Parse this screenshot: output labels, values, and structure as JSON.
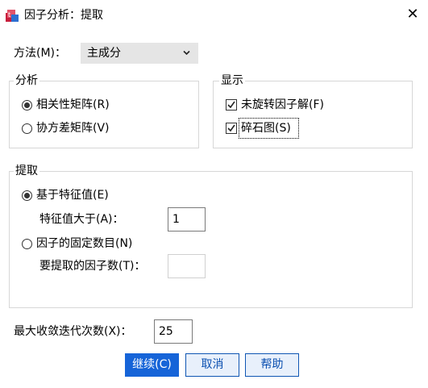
{
  "window": {
    "title": "因子分析：提取",
    "icon": "factor-analysis-app-icon",
    "close_icon": "close-icon"
  },
  "method": {
    "label": "方法(M)：",
    "value": "主成分"
  },
  "analyze": {
    "legend": "分析",
    "options": [
      {
        "label": "相关性矩阵(R)",
        "selected": true
      },
      {
        "label": "协方差矩阵(V)",
        "selected": false
      }
    ]
  },
  "display": {
    "legend": "显示",
    "options": [
      {
        "label": "未旋转因子解(F)",
        "checked": true
      },
      {
        "label": "碎石图(S)",
        "checked": true
      }
    ]
  },
  "extract": {
    "legend": "提取",
    "based_on_eigen_label": "基于特征值(E)",
    "eigen_greater_label": "特征值大于(A)：",
    "eigen_value": "1",
    "fixed_count_label": "因子的固定数目(N)",
    "factors_to_extract_label": "要提取的因子数(T)：",
    "factors_to_extract_value": ""
  },
  "max_iterations": {
    "label": "最大收敛迭代次数(X)：",
    "value": "25"
  },
  "buttons": {
    "continue": "继续(C)",
    "cancel": "取消",
    "help": "帮助"
  },
  "colors": {
    "primary": "#1664d8",
    "group_border": "#d7d7d7"
  }
}
